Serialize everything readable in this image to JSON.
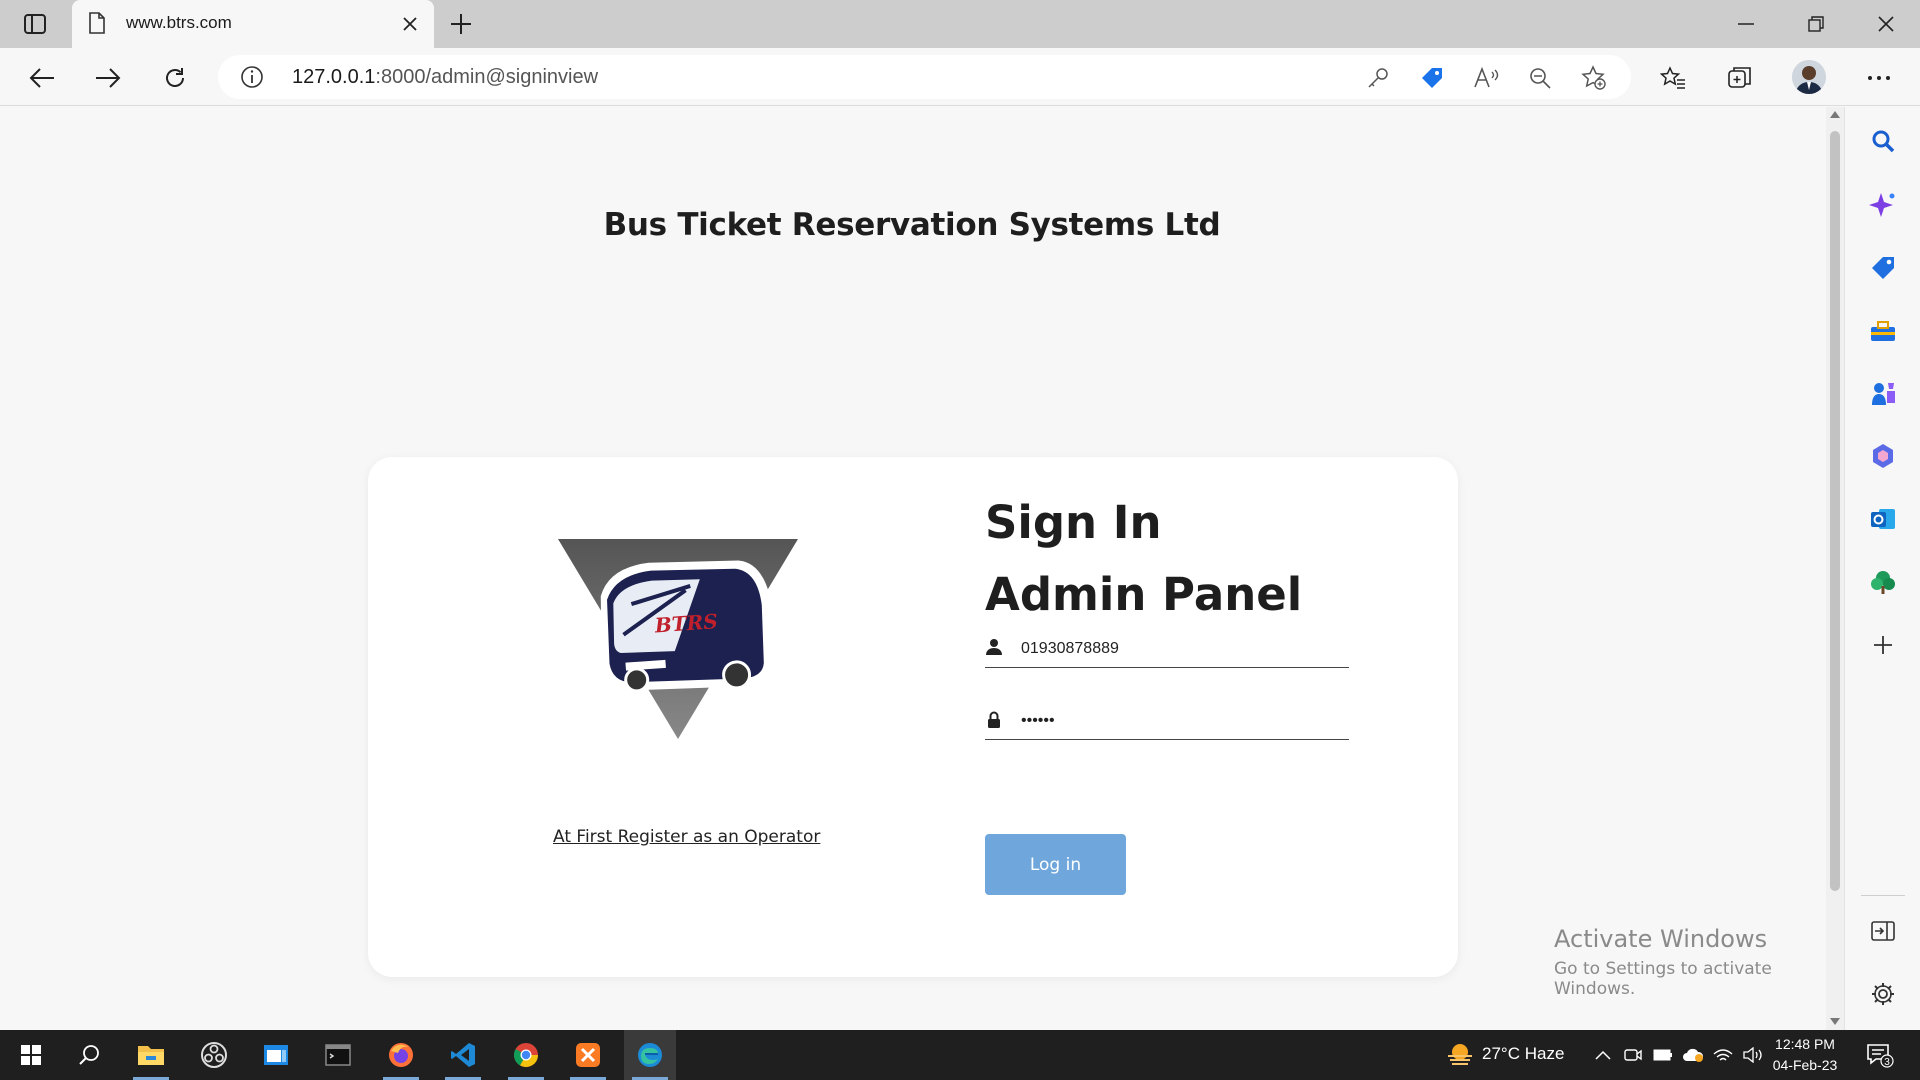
{
  "browser": {
    "tab_title": "www.btrs.com",
    "url_host": "127.0.0.1",
    "url_rest": ":8000/admin@signinview"
  },
  "page": {
    "site_title": "Bus Ticket Reservation Systems Ltd",
    "logo_text": "BTRS",
    "register_link": "At First Register as an Operator",
    "form_title": "Sign In Admin Panel",
    "username_value": "01930878889",
    "password_value": "••••••",
    "login_button": "Log in"
  },
  "watermark": {
    "line1": "Activate Windows",
    "line2": "Go to Settings to activate Windows."
  },
  "taskbar": {
    "weather": "27°C  Haze",
    "time": "12:48 PM",
    "date": "04-Feb-23",
    "notification_count": "3"
  },
  "colors": {
    "login_button": "#6fa7dc",
    "sidebar_accent": "#2b6fd6",
    "taskbar": "#1f1f1f"
  }
}
